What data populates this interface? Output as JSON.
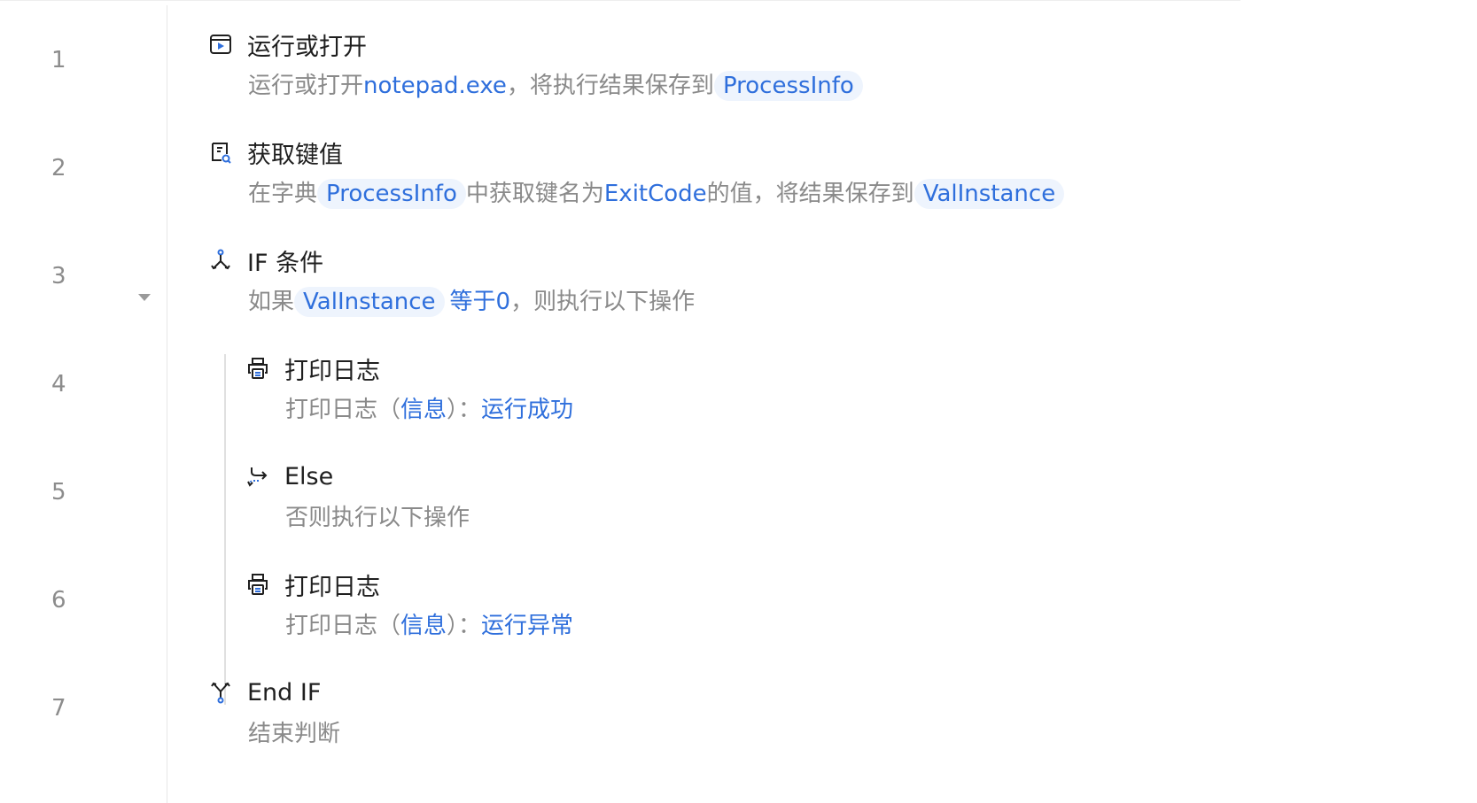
{
  "line_numbers": [
    "1",
    "2",
    "3",
    "4",
    "5",
    "6",
    "7"
  ],
  "steps": [
    {
      "title": "运行或打开",
      "icon": "run-window-icon",
      "desc": {
        "p1": "运行或打开",
        "lit1": "notepad.exe",
        "p2": "，将执行结果保存到",
        "var1": "ProcessInfo"
      }
    },
    {
      "title": "获取键值",
      "icon": "dictionary-key-icon",
      "desc": {
        "p1": "在字典",
        "var1": "ProcessInfo",
        "p2": "中获取键名为",
        "lit1": "ExitCode",
        "p3": "的值，将结果保存到",
        "var2": "ValInstance"
      }
    },
    {
      "title": "IF 条件",
      "icon": "branch-if-icon",
      "desc": {
        "p1": "如果",
        "var1": "ValInstance",
        "lit1": "等于0",
        "p2": "，则执行以下操作"
      }
    },
    {
      "title": "打印日志",
      "icon": "printer-icon",
      "desc": {
        "p1": "打印日志（",
        "lit1": "信息",
        "p2": "）：",
        "lit2": "运行成功"
      }
    },
    {
      "title": "Else",
      "icon": "else-branch-icon",
      "desc": {
        "p1": "否则执行以下操作"
      }
    },
    {
      "title": "打印日志",
      "icon": "printer-icon",
      "desc": {
        "p1": "打印日志（",
        "lit1": "信息",
        "p2": "）：",
        "lit2": "运行异常"
      }
    },
    {
      "title": "End IF",
      "icon": "merge-end-if-icon",
      "desc": {
        "p1": "结束判断"
      }
    }
  ],
  "colors": {
    "accent": "#2f6fdc",
    "variable_bg": "#eef4fd",
    "muted_text": "#8a8a8a",
    "title_text": "#1f1f1f"
  }
}
